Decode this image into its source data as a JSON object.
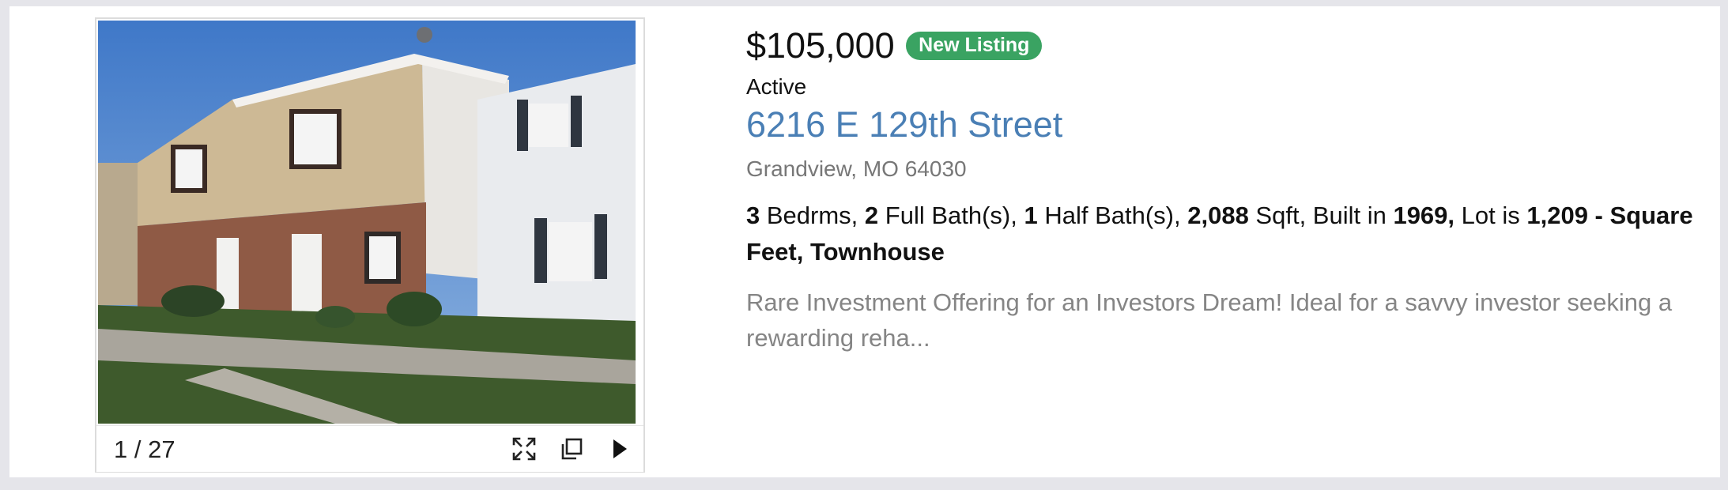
{
  "listing": {
    "price": "$105,000",
    "badge": "New Listing",
    "status": "Active",
    "address": "6216 E 129th Street",
    "city_line": "Grandview, MO 64030",
    "facts": {
      "beds_num": "3",
      "beds_label": " Bedrms, ",
      "full_bath_num": "2",
      "full_bath_label": " Full Bath(s), ",
      "half_bath_num": "1",
      "half_bath_label": " Half Bath(s), ",
      "sqft_num": "2,088",
      "sqft_label": " Sqft, Built in ",
      "year_built": "1969,",
      "lot_label": " Lot is ",
      "lot_value": "1,209 - Square Feet, Townhouse"
    },
    "description": "Rare Investment Offering for an Investors Dream! Ideal for a savvy investor seeking a rewarding reha..."
  },
  "gallery": {
    "counter": "1 / 27",
    "icons": [
      "fullscreen-icon",
      "open-popup-icon",
      "next-arrow-icon"
    ]
  },
  "colors": {
    "address_link": "#4a7fb5",
    "badge_green": "#3aa362",
    "muted_text": "#777777"
  }
}
